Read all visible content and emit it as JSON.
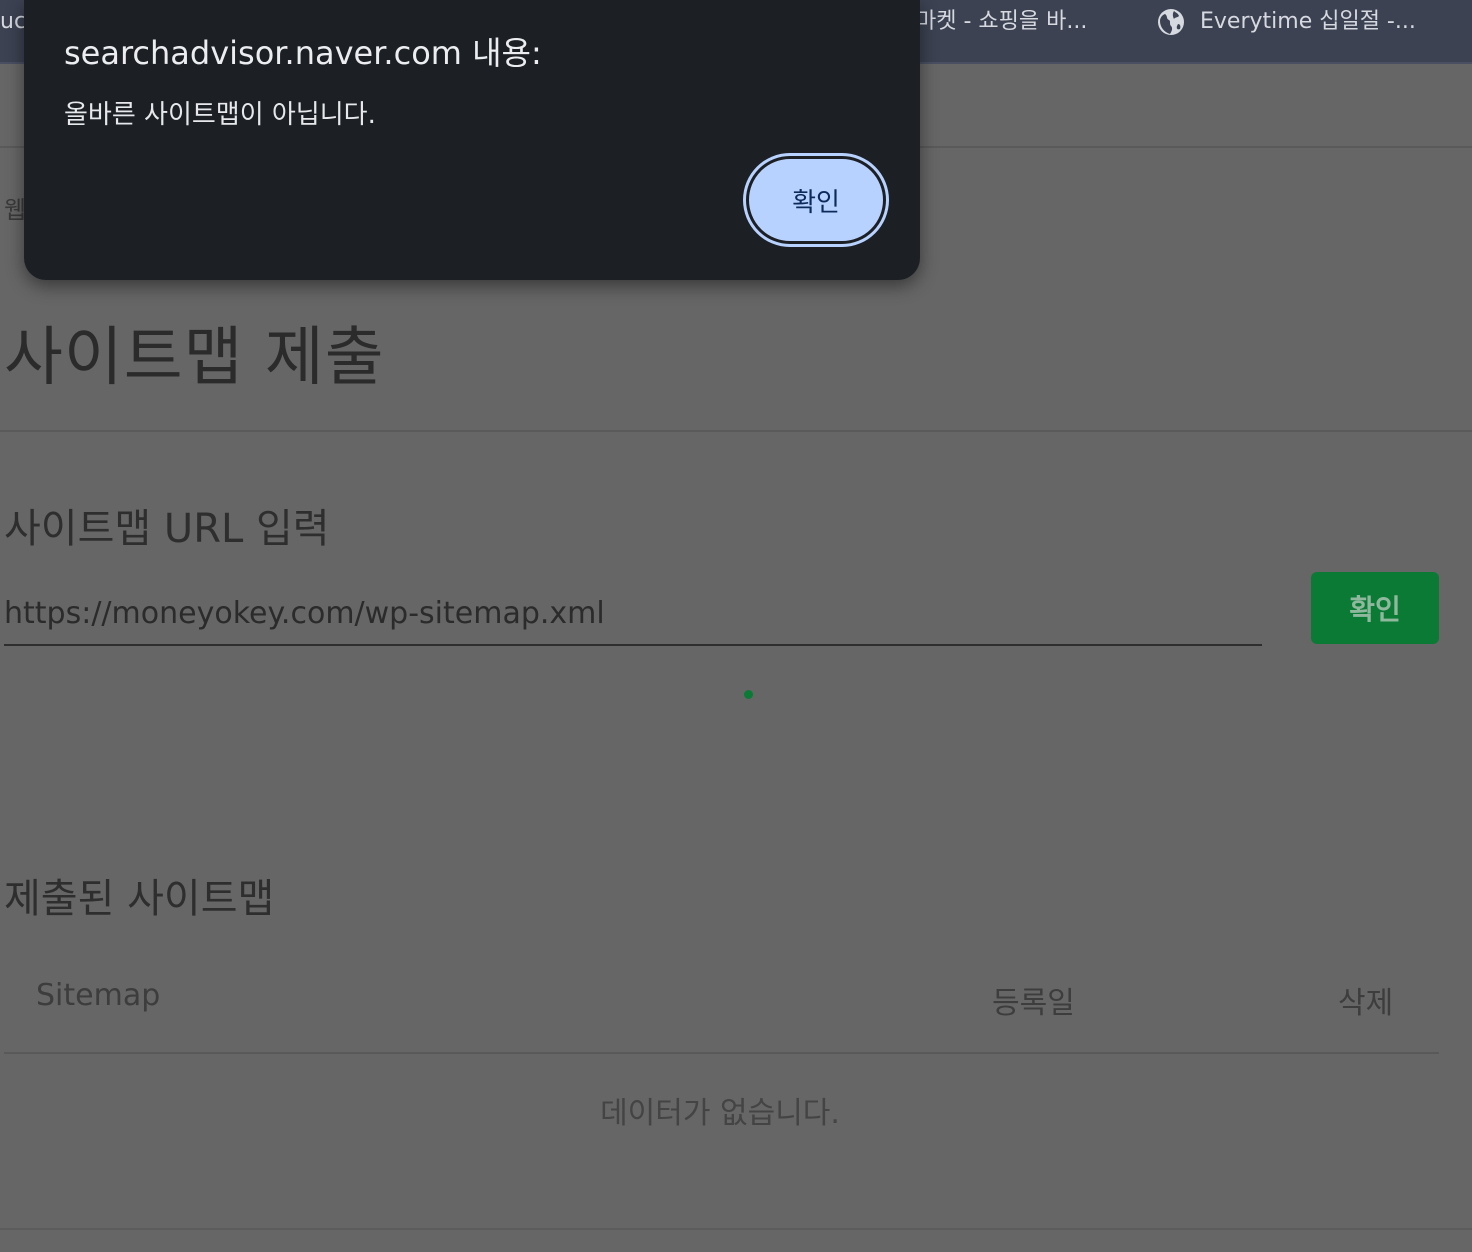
{
  "bookmarks": {
    "left_partial": "uc",
    "middle": "마켓 - 쇼핑을 바...",
    "right": "Everytime 십일절 -..."
  },
  "page": {
    "breadcrumb_partial": "웹",
    "title": "사이트맵 제출",
    "section_input_title": "사이트맵 URL 입력",
    "url_value": "https://moneyokey.com/wp-sitemap.xml",
    "submit_label": "확인",
    "section_list_title": "제출된 사이트맵",
    "table": {
      "headers": [
        "Sitemap",
        "등록일",
        "삭제"
      ],
      "empty_message": "데이터가 없습니다."
    },
    "accent_color": "#0a7a35"
  },
  "dialog": {
    "title": "searchadvisor.naver.com 내용:",
    "message": "올바른 사이트맵이 아닙니다.",
    "ok_label": "확인"
  },
  "icons": {
    "bookmark_right": "globe-icon"
  }
}
